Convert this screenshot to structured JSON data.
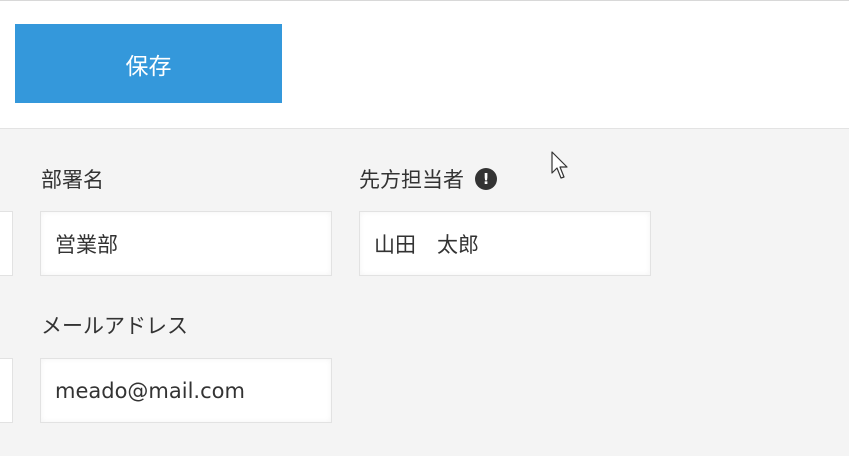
{
  "toolbar": {
    "save_label": "保存"
  },
  "form": {
    "department": {
      "label": "部署名",
      "value": "営業部"
    },
    "contact_person": {
      "label": "先方担当者",
      "info_icon_glyph": "!",
      "value": "山田　太郎"
    },
    "email": {
      "label": "メールアドレス",
      "value": "meado@mail.com"
    }
  },
  "colors": {
    "accent": "#3498db",
    "page_background": "#f4f4f4",
    "text": "#333333"
  },
  "icons": {
    "info": "exclamation-circle-icon",
    "pointer": "mouse-cursor-icon"
  }
}
